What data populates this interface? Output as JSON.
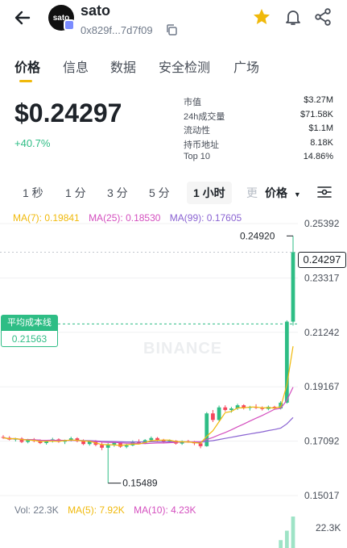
{
  "header": {
    "logo_text": "sato",
    "token_name": "sato",
    "address": "0x829f...7d7f09",
    "star_color": "#f0b90b"
  },
  "tabs": [
    "价格",
    "信息",
    "数据",
    "安全检测",
    "广场"
  ],
  "price": {
    "value": "$0.24297",
    "change": "+40.7%",
    "change_color": "#2ebd85"
  },
  "stats": [
    {
      "label": "市值",
      "value": "$3.27M"
    },
    {
      "label": "24h成交量",
      "value": "$71.58K"
    },
    {
      "label": "流动性",
      "value": "$1.1M"
    },
    {
      "label": "持币地址",
      "value": "8.18K"
    },
    {
      "label": "Top 10",
      "value": "14.86%"
    }
  ],
  "intervals": [
    "1 秒",
    "1 分",
    "3 分",
    "5 分",
    "1 小时",
    "更"
  ],
  "active_interval": "1 小时",
  "price_type": "价格",
  "ma": {
    "ma7": "MA(7): 0.19841",
    "ma25": "MA(25): 0.18530",
    "ma99": "MA(99): 0.17605"
  },
  "avg_cost": {
    "title": "平均成本线",
    "value": "0.21563"
  },
  "current_price_tag": "0.24297",
  "watermark": "BINANCE",
  "volume": {
    "vol": "Vol: 22.3K",
    "ma5": "MA(5): 7.92K",
    "ma10": "MA(10): 4.23K",
    "max_label": "22.3K"
  },
  "chart_data": {
    "type": "candlestick",
    "y_ticks": [
      "0.25392",
      "0.23317",
      "0.21242",
      "0.19167",
      "0.17092",
      "0.15017"
    ],
    "ylim": [
      0.15017,
      0.25392
    ],
    "high_label": "0.24920",
    "low_label": "0.15489",
    "up_color": "#2ebd85",
    "down_color": "#f6465d",
    "candles": [
      [
        0.1725,
        0.1732,
        0.1718,
        0.1722
      ],
      [
        0.1722,
        0.1728,
        0.1712,
        0.1715
      ],
      [
        0.1715,
        0.1722,
        0.1708,
        0.1719
      ],
      [
        0.1719,
        0.1724,
        0.1702,
        0.1706
      ],
      [
        0.1706,
        0.1718,
        0.1701,
        0.1714
      ],
      [
        0.1714,
        0.1721,
        0.1705,
        0.171
      ],
      [
        0.171,
        0.1716,
        0.1698,
        0.1702
      ],
      [
        0.1702,
        0.1713,
        0.1696,
        0.1709
      ],
      [
        0.1709,
        0.1722,
        0.1704,
        0.1716
      ],
      [
        0.1716,
        0.172,
        0.1703,
        0.1707
      ],
      [
        0.1707,
        0.1715,
        0.1698,
        0.1712
      ],
      [
        0.1712,
        0.1726,
        0.1708,
        0.172
      ],
      [
        0.172,
        0.1724,
        0.1705,
        0.1709
      ],
      [
        0.1709,
        0.1716,
        0.1694,
        0.1698
      ],
      [
        0.1698,
        0.1712,
        0.1692,
        0.1708
      ],
      [
        0.1708,
        0.1713,
        0.169,
        0.1695
      ],
      [
        0.1695,
        0.1705,
        0.1675,
        0.1684
      ],
      [
        0.1684,
        0.1702,
        0.1549,
        0.1696
      ],
      [
        0.1696,
        0.1709,
        0.1688,
        0.1704
      ],
      [
        0.1704,
        0.1707,
        0.1684,
        0.1688
      ],
      [
        0.1688,
        0.1699,
        0.1682,
        0.1693
      ],
      [
        0.1693,
        0.1712,
        0.169,
        0.1708
      ],
      [
        0.1708,
        0.1716,
        0.1697,
        0.1702
      ],
      [
        0.1702,
        0.1717,
        0.1698,
        0.1713
      ],
      [
        0.1713,
        0.1727,
        0.1707,
        0.1721
      ],
      [
        0.1721,
        0.1725,
        0.1709,
        0.1713
      ],
      [
        0.1713,
        0.1718,
        0.1703,
        0.1707
      ],
      [
        0.1707,
        0.1716,
        0.1702,
        0.1711
      ],
      [
        0.1711,
        0.1713,
        0.1696,
        0.17
      ],
      [
        0.17,
        0.1712,
        0.1695,
        0.1709
      ],
      [
        0.1709,
        0.1714,
        0.1703,
        0.1705
      ],
      [
        0.1705,
        0.171,
        0.1694,
        0.1701
      ],
      [
        0.1701,
        0.1705,
        0.1682,
        0.169
      ],
      [
        0.169,
        0.182,
        0.1688,
        0.1815
      ],
      [
        0.1815,
        0.1828,
        0.1782,
        0.179
      ],
      [
        0.179,
        0.1845,
        0.1786,
        0.1838
      ],
      [
        0.1838,
        0.1846,
        0.1822,
        0.1828
      ],
      [
        0.1828,
        0.184,
        0.1818,
        0.1834
      ],
      [
        0.1834,
        0.1852,
        0.1828,
        0.1846
      ],
      [
        0.1846,
        0.185,
        0.183,
        0.1836
      ],
      [
        0.1836,
        0.1844,
        0.1826,
        0.184
      ],
      [
        0.184,
        0.185,
        0.1832,
        0.1836
      ],
      [
        0.1836,
        0.1842,
        0.1826,
        0.1832
      ],
      [
        0.1832,
        0.1845,
        0.1827,
        0.184
      ],
      [
        0.184,
        0.1844,
        0.183,
        0.1834
      ],
      [
        0.1834,
        0.1862,
        0.183,
        0.1856
      ],
      [
        0.1856,
        0.217,
        0.1852,
        0.2165
      ],
      [
        0.2165,
        0.2492,
        0.215,
        0.243
      ]
    ]
  }
}
